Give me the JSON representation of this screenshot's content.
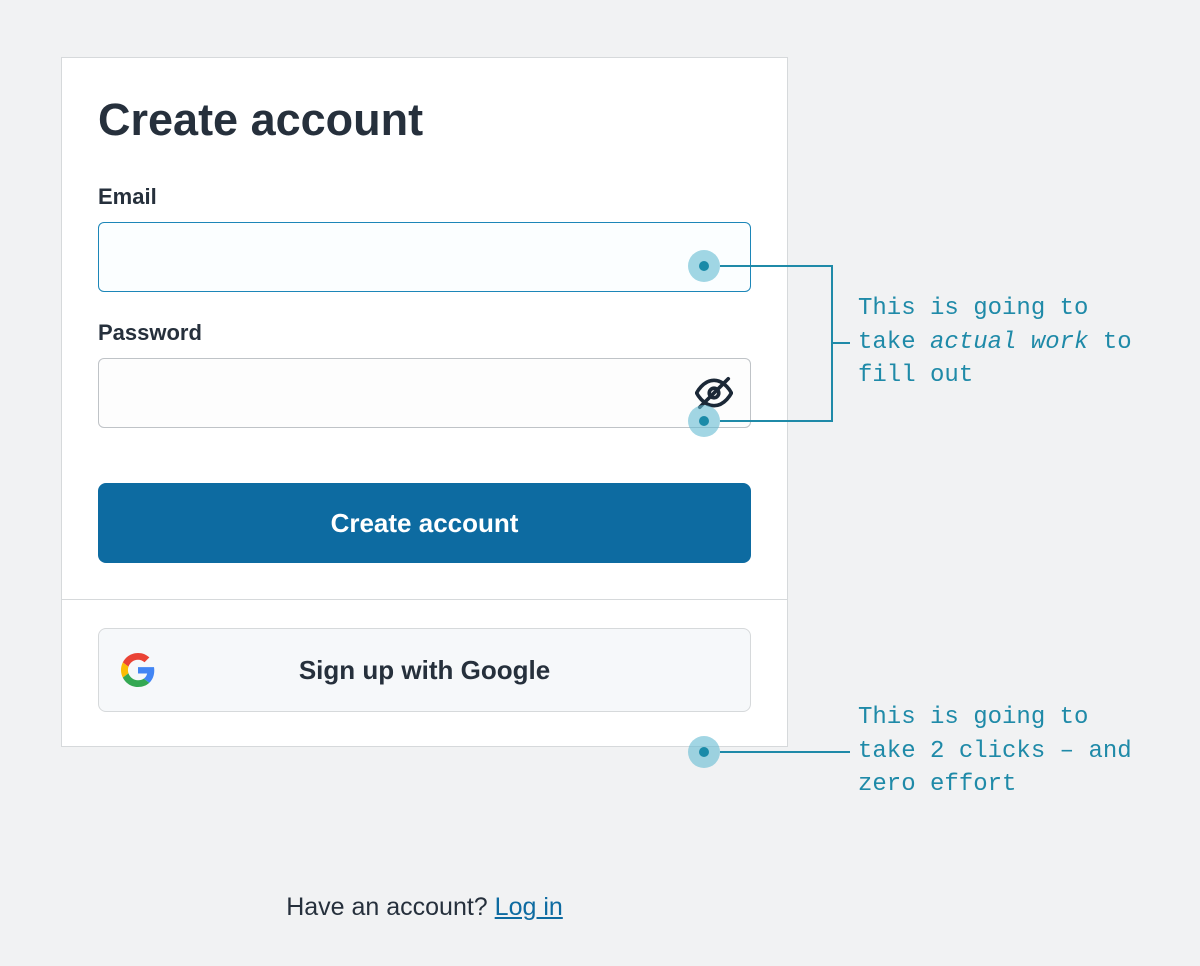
{
  "card": {
    "title": "Create account",
    "email_label": "Email",
    "email_value": "",
    "password_label": "Password",
    "password_value": "",
    "submit_label": "Create account",
    "google_label": "Sign up with Google"
  },
  "footer": {
    "prompt": "Have an account? ",
    "link_label": "Log in"
  },
  "annotations": {
    "top_line1": "This is going to",
    "top_line2_pre": "take ",
    "top_line2_em": "actual work",
    "top_line2_post": " to",
    "top_line3": "fill out",
    "bottom_line1": "This is going to",
    "bottom_line2": "take 2 clicks – and",
    "bottom_line3": "zero effort"
  }
}
